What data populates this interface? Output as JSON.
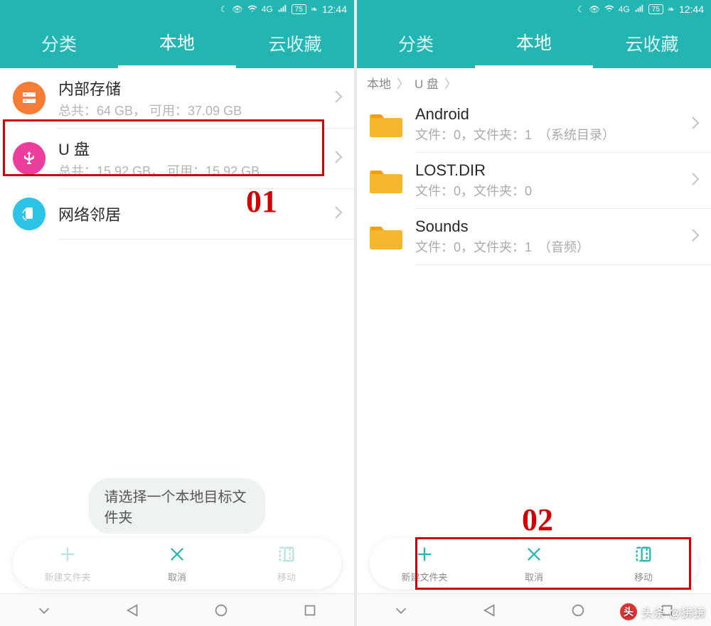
{
  "status": {
    "time": "12:44",
    "battery": "75",
    "net": "4G"
  },
  "tabs": {
    "cat": "分类",
    "local": "本地",
    "cloud": "云收藏"
  },
  "left": {
    "internal": {
      "title": "内部存储",
      "sub": "总共：64 GB， 可用：37.09 GB"
    },
    "usb": {
      "title": "U 盘",
      "sub": "总共：15.92 GB， 可用：15.92 GB"
    },
    "net": {
      "title": "网络邻居"
    },
    "hint": "请选择一个本地目标文件夹",
    "labels": {
      "annot": "01"
    }
  },
  "right": {
    "breadcrumb": {
      "a": "本地",
      "b": "U 盘"
    },
    "folders": [
      {
        "name": "Android",
        "sub": "文件：0，文件夹：1　（系统目录）"
      },
      {
        "name": "LOST.DIR",
        "sub": "文件：0，文件夹：0"
      },
      {
        "name": "Sounds",
        "sub": "文件：0，文件夹：1　（音频）"
      }
    ],
    "labels": {
      "annot": "02"
    }
  },
  "actions": {
    "new": "新建文件夹",
    "cancel": "取消",
    "move": "移动"
  },
  "watermark": {
    "text": "头条 @狒狒"
  }
}
